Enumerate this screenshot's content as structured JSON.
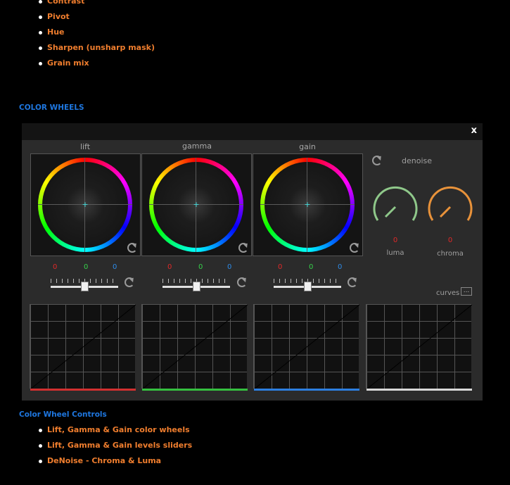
{
  "top_list": [
    "Contrast",
    "Pivot",
    "Hue",
    "Sharpen (unsharp mask)",
    "Grain mix"
  ],
  "section_heading": "COLOR WHEELS",
  "panel": {
    "close_label": "x",
    "wheels": [
      {
        "label": "lift",
        "r": "0",
        "g": "0",
        "b": "0",
        "level": 0.5
      },
      {
        "label": "gamma",
        "r": "0",
        "g": "0",
        "b": "0",
        "level": 0.5
      },
      {
        "label": "gain",
        "r": "0",
        "g": "0",
        "b": "0",
        "level": 0.5
      }
    ],
    "denoise_label": "denoise",
    "luma": {
      "label": "luma",
      "value": "0",
      "color": "#8fc88a"
    },
    "chroma": {
      "label": "chroma",
      "value": "0",
      "color": "#e8923a"
    },
    "curves_label": "curves",
    "curves_button": "...",
    "curve_colors": [
      "#d23030",
      "#35c040",
      "#2d7fe0",
      "#d8d8d8"
    ]
  },
  "controls_heading": "Color Wheel Controls",
  "bottom_list": [
    "Lift, Gamma & Gain color wheels",
    "Lift, Gamma & Gain levels sliders",
    "DeNoise - Chroma & Luma"
  ]
}
